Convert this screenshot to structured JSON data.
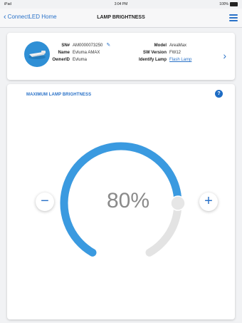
{
  "status_bar": {
    "carrier": "iPad",
    "time": "3:04 PM",
    "battery": "100%"
  },
  "nav": {
    "back_label": "ConnectLED Home",
    "title": "LAMP BRIGHTNESS"
  },
  "device": {
    "sn_label": "SN#",
    "sn_value": "AM0000073250",
    "name_label": "Name",
    "name_value": "Evluma AMAX",
    "owner_label": "OwnerID",
    "owner_value": "Evluma",
    "model_label": "Model",
    "model_value": "AreaMax",
    "sw_label": "SW Version",
    "sw_value": "FW12",
    "identify_label": "Identify Lamp",
    "identify_link": "Flash Lamp"
  },
  "brightness": {
    "title": "MAXIMUM LAMP BRIGHTNESS",
    "help_label": "?",
    "value_text": "80%",
    "value": 80,
    "minus_label": "−",
    "plus_label": "+"
  },
  "colors": {
    "accent": "#2a72c8",
    "arc_fill": "#3a9ae0",
    "arc_track": "#e3e3e3"
  }
}
